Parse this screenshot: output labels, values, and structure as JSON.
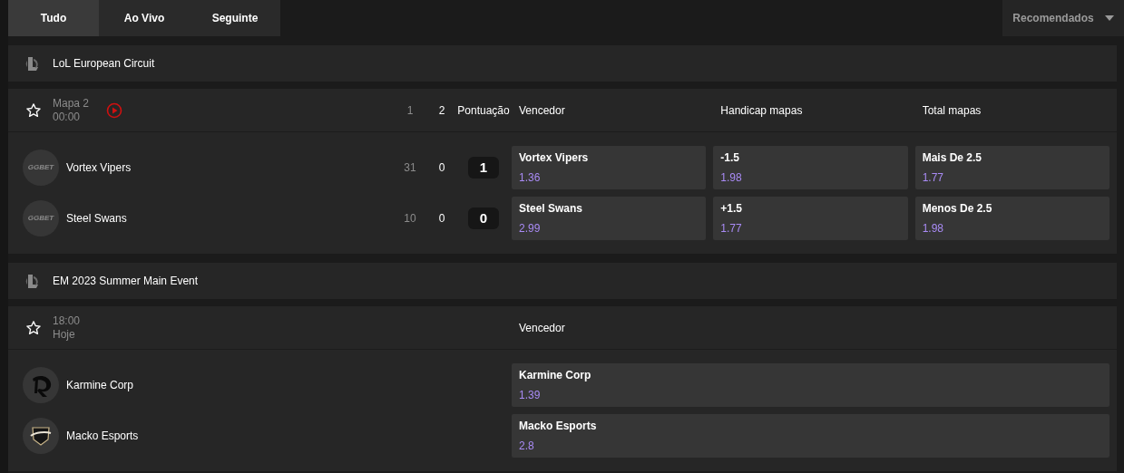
{
  "tabs": [
    {
      "label": "Tudo",
      "selected": true
    },
    {
      "label": "Ao Vivo",
      "selected": false
    },
    {
      "label": "Seguinte",
      "selected": false
    }
  ],
  "sort_dropdown": {
    "value": "Recomendados"
  },
  "sections": [
    {
      "league": "LoL European Circuit",
      "match": {
        "favorite": false,
        "line_1": "Mapa 2",
        "line_2": "00:00",
        "live": true,
        "score_columns": [
          "1",
          "2",
          "Pontuação"
        ],
        "markets": [
          "Vencedor",
          "Handicap mapas",
          "Total mapas"
        ],
        "teams": [
          {
            "name": "Vortex Vipers",
            "kind": "ggbet",
            "logo_text": "GGBET",
            "scores": [
              "31",
              "0"
            ],
            "total": "1",
            "odds": [
              {
                "label": "Vortex Vipers",
                "price": "1.36"
              },
              {
                "label": "-1.5",
                "price": "1.98"
              },
              {
                "label": "Mais De 2.5",
                "price": "1.77"
              }
            ]
          },
          {
            "name": "Steel Swans",
            "kind": "ggbet",
            "logo_text": "GGBET",
            "scores": [
              "10",
              "0"
            ],
            "total": "0",
            "odds": [
              {
                "label": "Steel Swans",
                "price": "2.99"
              },
              {
                "label": "+1.5",
                "price": "1.77"
              },
              {
                "label": "Menos De 2.5",
                "price": "1.98"
              }
            ]
          }
        ]
      }
    },
    {
      "league": "EM 2023 Summer Main Event",
      "match": {
        "favorite": false,
        "line_1": "18:00",
        "line_2": "Hoje",
        "live": false,
        "markets": [
          "Vencedor"
        ],
        "teams": [
          {
            "name": "Karmine Corp",
            "kind": "karmine",
            "odds": [
              {
                "label": "Karmine Corp",
                "price": "1.39"
              }
            ]
          },
          {
            "name": "Macko Esports",
            "kind": "macko",
            "odds": [
              {
                "label": "Macko Esports",
                "price": "2.8"
              }
            ]
          }
        ]
      }
    }
  ]
}
